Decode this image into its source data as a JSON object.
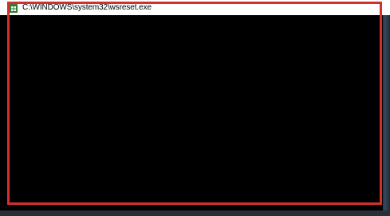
{
  "window": {
    "title": "C:\\WINDOWS\\system32\\wsreset.exe",
    "icon": "store-app-icon",
    "console_background": "#000000"
  },
  "annotation": {
    "type": "highlight-box",
    "color": "#d32f2f"
  }
}
